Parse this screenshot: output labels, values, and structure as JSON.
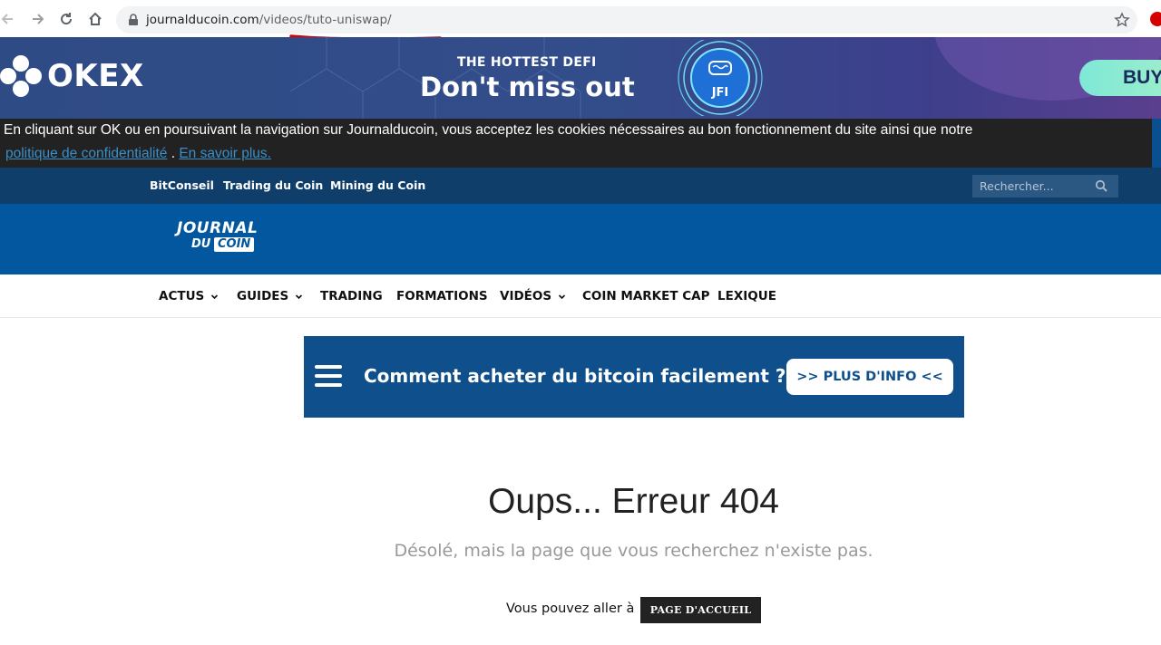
{
  "browser": {
    "url_domain": "journalducoin.com",
    "url_path": "/videos/tuto-uniswap/",
    "icons": [
      "back-icon",
      "forward-icon",
      "reload-icon",
      "home-icon",
      "lock-icon",
      "star-icon"
    ]
  },
  "ad": {
    "brand": "OKEX",
    "tagline": "THE HOTTEST DEFI",
    "headline": "Don't miss out",
    "badge": "JFI",
    "cta": "BUY"
  },
  "cookie": {
    "text": "En cliquant sur OK ou en poursuivant la navigation sur Journalducoin, vous acceptez les cookies nécessaires au bon fonctionnement du site ainsi que notre",
    "privacy_link": "politique de confidentialité",
    "separator": " . ",
    "more_link": "En savoir plus."
  },
  "top_nav": {
    "links": [
      "BitConseil",
      "Trading du Coin",
      "Mining du Coin"
    ],
    "search_placeholder": "Rechercher..."
  },
  "logo": {
    "line1": "JOURNAL",
    "line2": "DU",
    "line3": "COIN"
  },
  "main_nav": {
    "items": [
      "ACTUS",
      "GUIDES",
      "TRADING",
      "FORMATIONS",
      "VIDÉOS",
      "COIN MARKET CAP",
      "LEXIQUE"
    ]
  },
  "promo": {
    "text": "Comment acheter du bitcoin facilement ?",
    "button": ">> PLUS D'INFO <<"
  },
  "error": {
    "title": "Oups... Erreur 404",
    "subtitle": "Désolé, mais la page que vous recherchez n'existe pas.",
    "goto_text": "Vous pouvez aller à",
    "home_button": "PAGE D'ACCUEIL"
  },
  "colors": {
    "top_nav_bg": "#0f3e6b",
    "header_bg": "#02579e",
    "cookie_bg": "#222222",
    "link_blue": "#3a8ec9",
    "annotation_red": "#e00000"
  }
}
